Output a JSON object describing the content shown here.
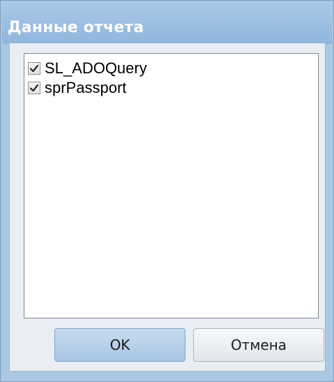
{
  "dialog": {
    "title": "Данные отчета"
  },
  "list": {
    "items": [
      {
        "label": "SL_ADOQuery",
        "checked": true
      },
      {
        "label": "sprPassport",
        "checked": true
      }
    ]
  },
  "buttons": {
    "ok_label": "OK",
    "cancel_label": "Отмена"
  },
  "colors": {
    "titlebar": "#8fb6dc",
    "ok_button": "#a9c6e2"
  }
}
